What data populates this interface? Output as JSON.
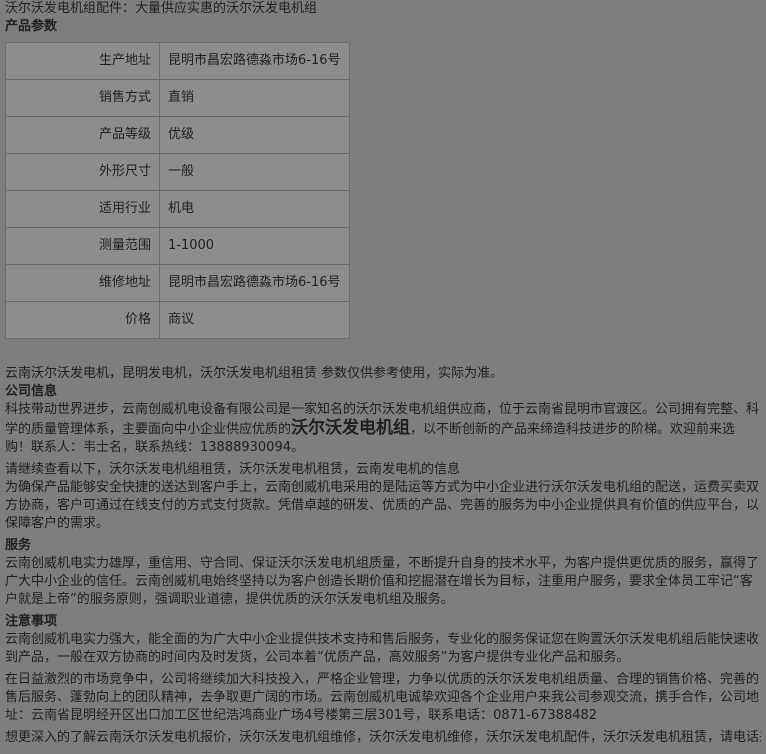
{
  "header": {
    "title_line": "沃尔沃发电机组配件：大量供应实惠的沃尔沃发电机组",
    "params_heading": "产品参数"
  },
  "params": [
    {
      "key": "生产地址",
      "value": "昆明市昌宏路德淼市场6-16号"
    },
    {
      "key": "销售方式",
      "value": "直销"
    },
    {
      "key": "产品等级",
      "value": "优级"
    },
    {
      "key": "外形尺寸",
      "value": "一般"
    },
    {
      "key": "适用行业",
      "value": "机电"
    },
    {
      "key": "测量范围",
      "value": "1-1000"
    },
    {
      "key": "维修地址",
      "value": "昆明市昌宏路德淼市场6-16号"
    },
    {
      "key": "价格",
      "value": "商议"
    }
  ],
  "note": "云南沃尔沃发电机，昆明发电机，沃尔沃发电机组租赁 参数仅供参考使用，实际为准。",
  "company": {
    "heading": "公司信息",
    "intro_pre": "科技带动世界进步，云南创威机电设备有限公司是一家知名的沃尔沃发电机组供应商，位于云南省昆明市官渡区。公司拥有完整、科学的质量管理体系，主要面向中小企业供应优质的",
    "intro_big": "沃尔沃发电机组",
    "intro_post": "，以不断创新的产品来缔造科技进步的阶梯。欢迎前来选购！联系人：韦士名，联系热线：13888930094。",
    "continue_line": "请继续查看以下，沃尔沃发电机组租赁，沃尔沃发电机租赁，云南发电机的信息",
    "delivery": "为确保产品能够安全快捷的送达到客户手上，云南创威机电采用的是陆运等方式为中小企业进行沃尔沃发电机组的配送，运费买卖双方协商，客户可通过在线支付的方式支付货款。凭借卓越的研发、优质的产品、完善的服务为中小企业提供具有价值的供应平台，以保障客户的需求。"
  },
  "service": {
    "heading": "服务",
    "p1": "云南创威机电实力雄厚，重信用、守合同、保证沃尔沃发电机组质量，不断提升自身的技术水平，为客户提供更优质的服务，赢得了广大中小企业的信任。云南创威机电始终坚持以为客户创造长期价值和挖掘潜在增长为目标，注重用户服务，要求全体员工牢记“客户就是上帝”的服务原则，强调职业道德，提供优质的沃尔沃发电机组及服务。"
  },
  "notice": {
    "heading": "注意事项",
    "p1": "云南创威机电实力强大，能全面的为广大中小企业提供技术支持和售后服务，专业化的服务保证您在购置沃尔沃发电机组后能快速收到产品，一般在双方协商的时间内及时发货，公司本着“优质产品，高效服务”为客户提供专业化产品和服务。",
    "p2": "在日益激烈的市场竞争中，公司将继续加大科技投入，严格企业管理，力争以优质的沃尔沃发电机组质量、合理的销售价格、完善的售后服务、蓬勃向上的团队精神，去争取更广阔的市场。云南创威机电诚挚欢迎各个企业用户来我公司参观交流，携手合作，公司地址：云南省昆明经开区出口加工区世纪浩鸿商业广场4号楼第三层301号，联系电话：0871-67388482",
    "p3": "想更深入的了解云南沃尔沃发电机报价，沃尔沃发电机组维修，沃尔沃发电机维修，沃尔沃发电机配件，沃尔沃发电机租赁，请电话来询"
  }
}
